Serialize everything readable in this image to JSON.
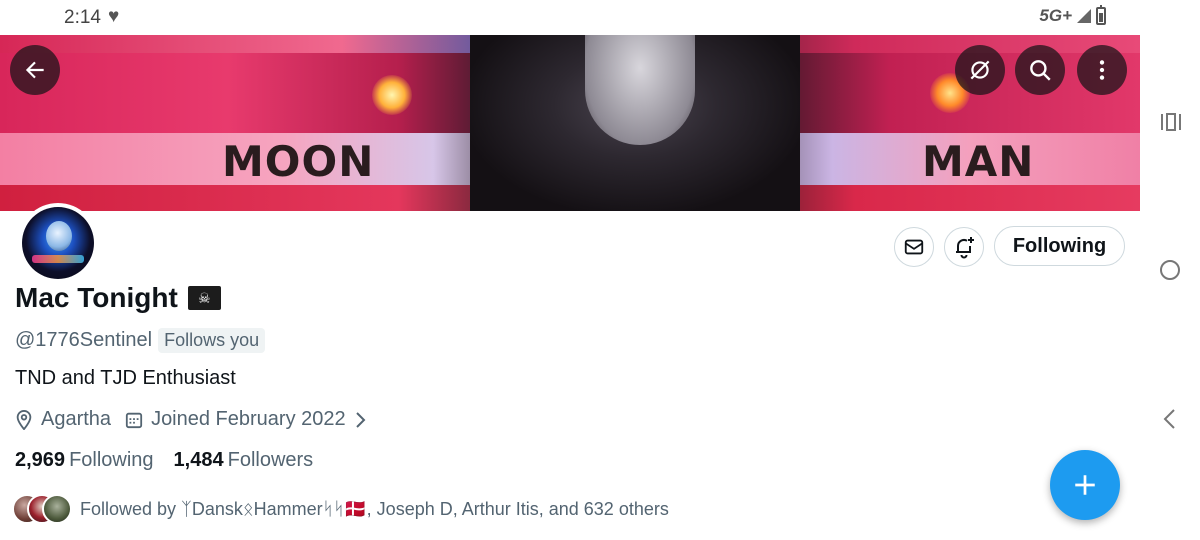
{
  "status_bar": {
    "time": "2:14",
    "network": "5G+"
  },
  "banner": {
    "left_word": "MOON",
    "right_word": "MAN"
  },
  "profile": {
    "display_name": "Mac Tonight",
    "name_emoji": "pirate-flag-icon",
    "handle": "@1776Sentinel",
    "follows_you_badge": "Follows you",
    "bio": "TND and TJD Enthusiast",
    "location": "Agartha",
    "joined": "Joined February 2022",
    "following_count": "2,969",
    "following_label": "Following",
    "followers_count": "1,484",
    "followers_label": "Followers",
    "followed_by": "Followed by ᛉDanskᛟHammerᛋᛋ🇩🇰, Joseph D, Arthur Itis, and 632 others"
  },
  "actions": {
    "following_button": "Following"
  },
  "colors": {
    "accent": "#1d9bf0",
    "secondary_text": "#536471",
    "primary_text": "#0f1419"
  }
}
